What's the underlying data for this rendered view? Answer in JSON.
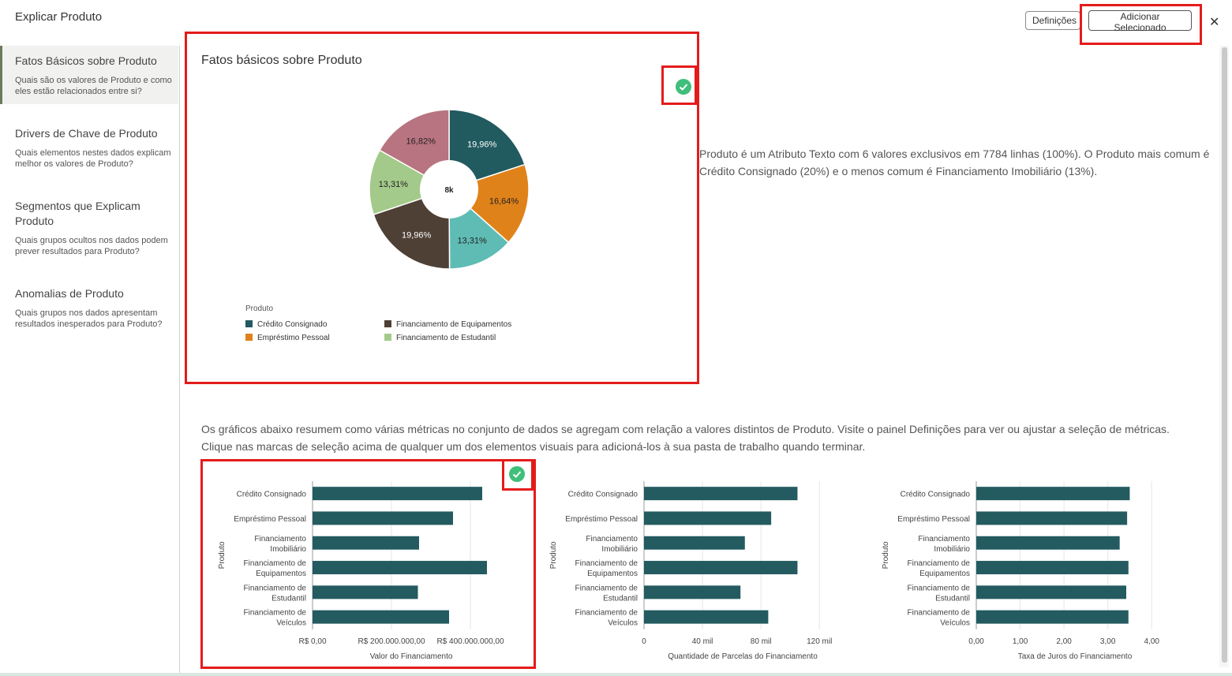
{
  "header": {
    "title": "Explicar Produto",
    "settings_label": "Definições",
    "add_selected_label": "Adicionar Selecionado",
    "close_icon": "close-icon"
  },
  "sidebar": {
    "items": [
      {
        "title": "Fatos Básicos sobre Produto",
        "desc": "Quais são os valores de Produto e como eles estão relacionados entre si?"
      },
      {
        "title": "Drivers de Chave de Produto",
        "desc": "Quais elementos nestes dados explicam melhor os valores de Produto?"
      },
      {
        "title": "Segmentos que Explicam Produto",
        "desc": "Quais grupos ocultos nos dados podem prever resultados para Produto?"
      },
      {
        "title": "Anomalias de Produto",
        "desc": "Quais grupos nos dados apresentam resultados inesperados para Produto?"
      }
    ]
  },
  "main": {
    "panel_title": "Fatos básicos sobre Produto",
    "description": "Produto é um Atributo Texto com 6 valores exclusivos em 7784 linhas (100%). O Produto mais comum é Crédito Consignado (20%) e o menos comum é Financiamento Imobiliário (13%).",
    "summary": "Os gráficos abaixo resumem como várias métricas no conjunto de dados se agregam com relação a valores distintos de Produto. Visite o painel Definições para ver ou ajustar a seleção de métricas. Clique nas marcas de seleção acima de qualquer um dos elementos visuais para adicioná-los à sua pasta de trabalho quando terminar."
  },
  "colors": {
    "Crédito Consignado": "#215a5f",
    "Empréstimo Pessoal": "#e0821a",
    "Financiamento Imobiliário": "#5fbcb5",
    "Financiamento de Equipamentos": "#4f4036",
    "Financiamento de Estudantil": "#a3ca8a",
    "Financiamento de Veículos": "#b87480",
    "bar": "#235b60",
    "check": "#3fbf7a",
    "highlight": "#e41b1b"
  },
  "chart_data": [
    {
      "type": "pie",
      "center_label": "8k",
      "legend_title": "Produto",
      "slices": [
        {
          "name": "Crédito Consignado",
          "value": 19.96,
          "label": "19,96%"
        },
        {
          "name": "Empréstimo Pessoal",
          "value": 16.64,
          "label": "16,64%"
        },
        {
          "name": "Financiamento Imobiliário",
          "value": 13.31,
          "label": "13,31%"
        },
        {
          "name": "Financiamento de Equipamentos",
          "value": 19.96,
          "label": "19,96%"
        },
        {
          "name": "Financiamento de Estudantil",
          "value": 13.31,
          "label": "13,31%"
        },
        {
          "name": "Financiamento de Veículos",
          "value": 16.82,
          "label": "16,82%"
        }
      ],
      "legend": [
        "Crédito Consignado",
        "Financiamento de Equipamentos",
        "Empréstimo Pessoal",
        "Financiamento de Estudantil"
      ]
    },
    {
      "type": "bar",
      "orientation": "horizontal",
      "ylabel": "Produto",
      "xlabel": "Valor do Financiamento",
      "categories": [
        [
          "Crédito Consignado"
        ],
        [
          "Empréstimo Pessoal"
        ],
        [
          "Financiamento",
          "Imobiliário"
        ],
        [
          "Financiamento de",
          "Equipamentos"
        ],
        [
          "Financiamento de",
          "Estudantil"
        ],
        [
          "Financiamento de",
          "Veículos"
        ]
      ],
      "values": [
        430000000,
        356000000,
        270000000,
        442000000,
        267000000,
        346000000
      ],
      "xlim": [
        0,
        500000000
      ],
      "ticks": [
        {
          "v": 0,
          "label": "R$ 0,00"
        },
        {
          "v": 200000000,
          "label": "R$ 200.000.000,00"
        },
        {
          "v": 400000000,
          "label": "R$ 400.000.000,00"
        }
      ]
    },
    {
      "type": "bar",
      "orientation": "horizontal",
      "ylabel": "Produto",
      "xlabel": "Quantidade de Parcelas do Financiamento",
      "categories": [
        [
          "Crédito Consignado"
        ],
        [
          "Empréstimo Pessoal"
        ],
        [
          "Financiamento",
          "Imobiliário"
        ],
        [
          "Financiamento de",
          "Equipamentos"
        ],
        [
          "Financiamento de",
          "Estudantil"
        ],
        [
          "Financiamento de",
          "Veículos"
        ]
      ],
      "values": [
        105000,
        87000,
        69000,
        105000,
        66000,
        85000
      ],
      "xlim": [
        0,
        135000
      ],
      "ticks": [
        {
          "v": 0,
          "label": "0"
        },
        {
          "v": 40000,
          "label": "40 mil"
        },
        {
          "v": 80000,
          "label": "80 mil"
        },
        {
          "v": 120000,
          "label": "120 mil"
        }
      ]
    },
    {
      "type": "bar",
      "orientation": "horizontal",
      "ylabel": "Produto",
      "xlabel": "Taxa de Juros do Financiamento",
      "categories": [
        [
          "Crédito Consignado"
        ],
        [
          "Empréstimo Pessoal"
        ],
        [
          "Financiamento",
          "Imobiliário"
        ],
        [
          "Financiamento de",
          "Equipamentos"
        ],
        [
          "Financiamento de",
          "Estudantil"
        ],
        [
          "Financiamento de",
          "Veículos"
        ]
      ],
      "values": [
        3.5,
        3.44,
        3.27,
        3.47,
        3.42,
        3.47
      ],
      "xlim": [
        0,
        4.5
      ],
      "ticks": [
        {
          "v": 0,
          "label": "0,00"
        },
        {
          "v": 1,
          "label": "1,00"
        },
        {
          "v": 2,
          "label": "2,00"
        },
        {
          "v": 3,
          "label": "3,00"
        },
        {
          "v": 4,
          "label": "4,00"
        }
      ]
    }
  ]
}
